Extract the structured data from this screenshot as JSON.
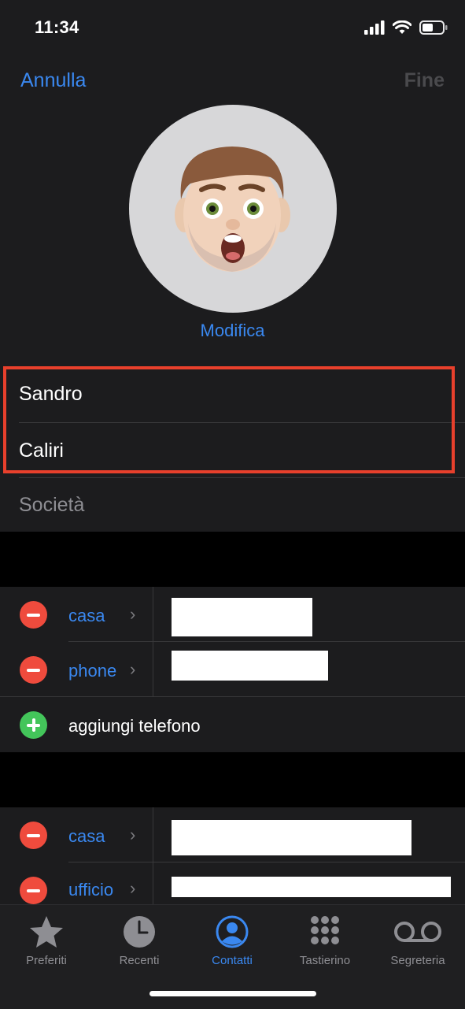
{
  "status_bar": {
    "time": "11:34"
  },
  "nav": {
    "cancel_label": "Annulla",
    "done_label": "Fine"
  },
  "avatar": {
    "edit_label": "Modifica"
  },
  "name_fields": {
    "first_name": "Sandro",
    "last_name": "Caliri",
    "company_placeholder": "Società"
  },
  "phones": {
    "items": [
      {
        "label": "casa"
      },
      {
        "label": "phone"
      }
    ],
    "add_label": "aggiungi telefono"
  },
  "emails": {
    "items": [
      {
        "label": "casa"
      },
      {
        "label": "ufficio"
      }
    ]
  },
  "tabbar": {
    "items": [
      {
        "label": "Preferiti",
        "icon": "star-icon"
      },
      {
        "label": "Recenti",
        "icon": "clock-icon"
      },
      {
        "label": "Contatti",
        "icon": "person-circle-icon",
        "active": true
      },
      {
        "label": "Tastierino",
        "icon": "keypad-icon"
      },
      {
        "label": "Segreteria",
        "icon": "voicemail-icon"
      }
    ]
  },
  "colors": {
    "accent": "#3a88f0",
    "delete": "#ef4b3d",
    "add": "#43c55a",
    "highlight": "#e8402c"
  }
}
